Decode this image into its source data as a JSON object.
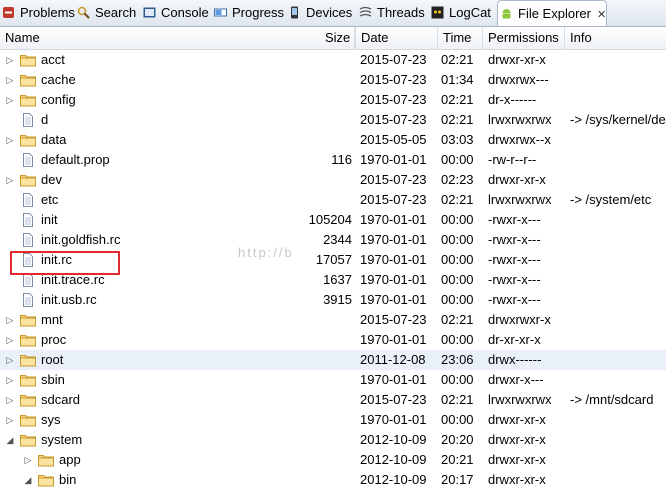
{
  "tabs": [
    {
      "label": "Problems",
      "icon": "problems-icon"
    },
    {
      "label": "Search",
      "icon": "search-icon"
    },
    {
      "label": "Console",
      "icon": "console-icon"
    },
    {
      "label": "Progress",
      "icon": "progress-icon"
    },
    {
      "label": "Devices",
      "icon": "device-icon"
    },
    {
      "label": "Threads",
      "icon": "threads-icon"
    },
    {
      "label": "LogCat",
      "icon": "logcat-icon"
    },
    {
      "label": "File Explorer",
      "icon": "android-icon",
      "active": true,
      "close": "✕"
    }
  ],
  "columns": {
    "name": "Name",
    "size": "Size",
    "date": "Date",
    "time": "Time",
    "permissions": "Permissions",
    "info": "Info"
  },
  "watermark": "http://b",
  "rows": [
    {
      "name": "acct",
      "type": "folder",
      "size": "",
      "date": "2015-07-23",
      "time": "02:21",
      "perm": "drwxr-xr-x",
      "info": ""
    },
    {
      "name": "cache",
      "type": "folder",
      "size": "",
      "date": "2015-07-23",
      "time": "01:34",
      "perm": "drwxrwx---",
      "info": ""
    },
    {
      "name": "config",
      "type": "folder",
      "size": "",
      "date": "2015-07-23",
      "time": "02:21",
      "perm": "dr-x------",
      "info": ""
    },
    {
      "name": "d",
      "type": "file",
      "size": "",
      "date": "2015-07-23",
      "time": "02:21",
      "perm": "lrwxrwxrwx",
      "info": "-> /sys/kernel/de"
    },
    {
      "name": "data",
      "type": "folder",
      "size": "",
      "date": "2015-05-05",
      "time": "03:03",
      "perm": "drwxrwx--x",
      "info": ""
    },
    {
      "name": "default.prop",
      "type": "file",
      "size": "116",
      "date": "1970-01-01",
      "time": "00:00",
      "perm": "-rw-r--r--",
      "info": ""
    },
    {
      "name": "dev",
      "type": "folder",
      "size": "",
      "date": "2015-07-23",
      "time": "02:23",
      "perm": "drwxr-xr-x",
      "info": ""
    },
    {
      "name": "etc",
      "type": "file",
      "size": "",
      "date": "2015-07-23",
      "time": "02:21",
      "perm": "lrwxrwxrwx",
      "info": "-> /system/etc"
    },
    {
      "name": "init",
      "type": "file",
      "size": "105204",
      "date": "1970-01-01",
      "time": "00:00",
      "perm": "-rwxr-x---",
      "info": ""
    },
    {
      "name": "init.goldfish.rc",
      "type": "file",
      "size": "2344",
      "date": "1970-01-01",
      "time": "00:00",
      "perm": "-rwxr-x---",
      "info": ""
    },
    {
      "name": "init.rc",
      "type": "file",
      "size": "17057",
      "date": "1970-01-01",
      "time": "00:00",
      "perm": "-rwxr-x---",
      "info": ""
    },
    {
      "name": "init.trace.rc",
      "type": "file",
      "size": "1637",
      "date": "1970-01-01",
      "time": "00:00",
      "perm": "-rwxr-x---",
      "info": ""
    },
    {
      "name": "init.usb.rc",
      "type": "file",
      "size": "3915",
      "date": "1970-01-01",
      "time": "00:00",
      "perm": "-rwxr-x---",
      "info": ""
    },
    {
      "name": "mnt",
      "type": "folder",
      "size": "",
      "date": "2015-07-23",
      "time": "02:21",
      "perm": "drwxrwxr-x",
      "info": ""
    },
    {
      "name": "proc",
      "type": "folder",
      "size": "",
      "date": "1970-01-01",
      "time": "00:00",
      "perm": "dr-xr-xr-x",
      "info": ""
    },
    {
      "name": "root",
      "type": "folder",
      "size": "",
      "date": "2011-12-08",
      "time": "23:06",
      "perm": "drwx------",
      "info": "",
      "selected": true
    },
    {
      "name": "sbin",
      "type": "folder",
      "size": "",
      "date": "1970-01-01",
      "time": "00:00",
      "perm": "drwxr-x---",
      "info": ""
    },
    {
      "name": "sdcard",
      "type": "folder",
      "size": "",
      "date": "2015-07-23",
      "time": "02:21",
      "perm": "lrwxrwxrwx",
      "info": "-> /mnt/sdcard"
    },
    {
      "name": "sys",
      "type": "folder",
      "size": "",
      "date": "1970-01-01",
      "time": "00:00",
      "perm": "drwxr-xr-x",
      "info": ""
    },
    {
      "name": "system",
      "type": "folder",
      "expanded": true,
      "size": "",
      "date": "2012-10-09",
      "time": "20:20",
      "perm": "drwxr-xr-x",
      "info": ""
    },
    {
      "name": "app",
      "type": "folder",
      "level": 1,
      "size": "",
      "date": "2012-10-09",
      "time": "20:21",
      "perm": "drwxr-xr-x",
      "info": ""
    },
    {
      "name": "bin",
      "type": "folder",
      "level": 1,
      "expanded": true,
      "size": "",
      "date": "2012-10-09",
      "time": "20:17",
      "perm": "drwxr-xr-x",
      "info": ""
    }
  ]
}
